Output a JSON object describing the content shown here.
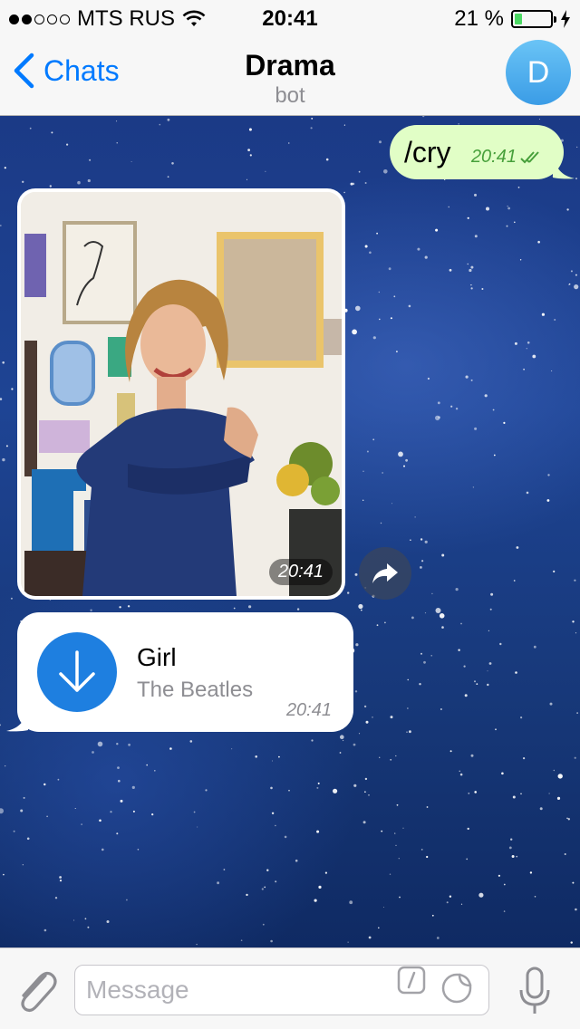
{
  "status_bar": {
    "carrier": "MTS RUS",
    "time": "20:41",
    "battery_percent": "21 %",
    "battery_level": 0.21,
    "signal_strength": 2
  },
  "header": {
    "back_label": "Chats",
    "title": "Drama",
    "subtitle": "bot",
    "avatar_letter": "D"
  },
  "messages": [
    {
      "type": "text",
      "direction": "outgoing",
      "text": "/cry",
      "time": "20:41",
      "status": "read"
    },
    {
      "type": "photo",
      "direction": "incoming",
      "time": "20:41"
    },
    {
      "type": "audio",
      "direction": "incoming",
      "title": "Girl",
      "performer": "The Beatles",
      "time": "20:41"
    }
  ],
  "input": {
    "placeholder": "Message",
    "value": ""
  },
  "colors": {
    "accent": "#007aff",
    "outgoing_bubble": "#e1fec6",
    "outgoing_meta": "#47a03b",
    "download_button": "#1e7fe0",
    "battery": "#4cd964"
  }
}
